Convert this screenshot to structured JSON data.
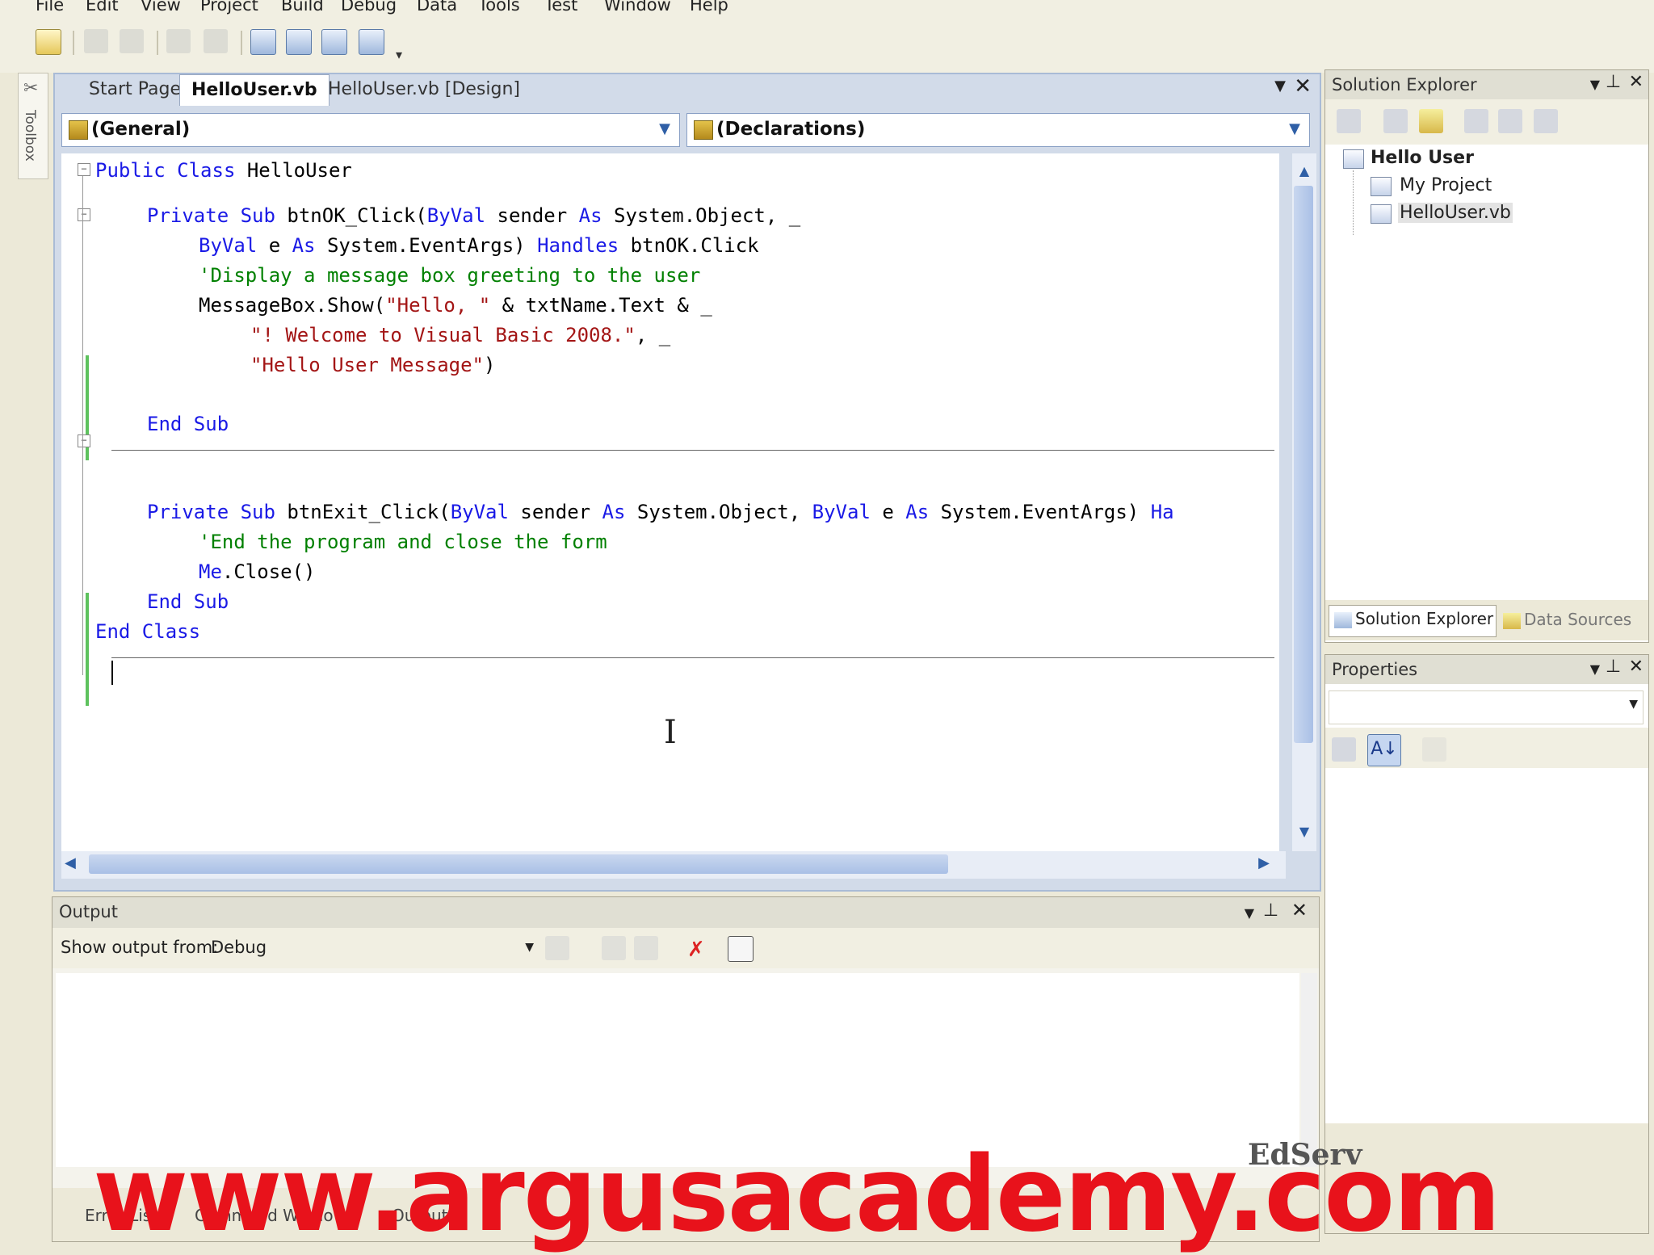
{
  "menu": [
    "File",
    "Edit",
    "View",
    "Project",
    "Build",
    "Debug",
    "Data",
    "Tools",
    "Test",
    "Window",
    "Help"
  ],
  "toolbox_label": "Toolbox",
  "editor": {
    "tabs": [
      "Start Page",
      "HelloUser.vb",
      "HelloUser.vb [Design]"
    ],
    "active_tab": "HelloUser.vb",
    "dropdown_left": "(General)",
    "dropdown_right": "(Declarations)"
  },
  "code": {
    "l1_kw": "Public Class",
    "l1_txt": " HelloUser",
    "l2_kw1": "Private Sub",
    "l2_txt1": " btnOK_Click(",
    "l2_kw2": "ByVal",
    "l2_txt2": " sender ",
    "l2_kw3": "As",
    "l2_txt3": " System.Object, _",
    "l3_kw1": "ByVal",
    "l3_txt1": " e ",
    "l3_kw2": "As",
    "l3_txt2": " System.EventArgs) ",
    "l3_kw3": "Handles",
    "l3_txt3": " btnOK.Click",
    "l4_cm": "'Display a message box greeting to the user",
    "l5_txt1": "MessageBox.Show(",
    "l5_st": "\"Hello, \"",
    "l5_txt2": " & txtName.Text & _",
    "l6_st": "\"! Welcome to Visual Basic 2008.\"",
    "l6_txt": ", _",
    "l7_st": "\"Hello User Message\"",
    "l7_txt": ")",
    "l8_kw": "End Sub",
    "l9_kw1": "Private Sub",
    "l9_txt1": " btnExit_Click(",
    "l9_kw2": "ByVal",
    "l9_txt2": " sender ",
    "l9_kw3": "As",
    "l9_txt3": " System.Object, ",
    "l9_kw4": "ByVal",
    "l9_txt4": " e ",
    "l9_kw5": "As",
    "l9_txt5": " System.EventArgs) ",
    "l9_kw6": "Ha",
    "l10_cm": "'End the program and close the form",
    "l11_kw": "Me",
    "l11_txt": ".Close()",
    "l12_kw": "End Sub",
    "l13_kw": "End Class"
  },
  "solution_explorer": {
    "title": "Solution Explorer",
    "root": "Hello User",
    "items": [
      "My Project",
      "HelloUser.vb"
    ],
    "bottom_tabs": [
      "Solution Explorer",
      "Data Sources"
    ]
  },
  "properties": {
    "title": "Properties"
  },
  "output": {
    "title": "Output",
    "show_from_label": "Show output from:",
    "show_from_value": "Debug",
    "bottom_tabs": [
      "Error List",
      "Command Window",
      "Output"
    ]
  },
  "watermark": "www.argusacademy.com",
  "corner_logo": "EdServ"
}
